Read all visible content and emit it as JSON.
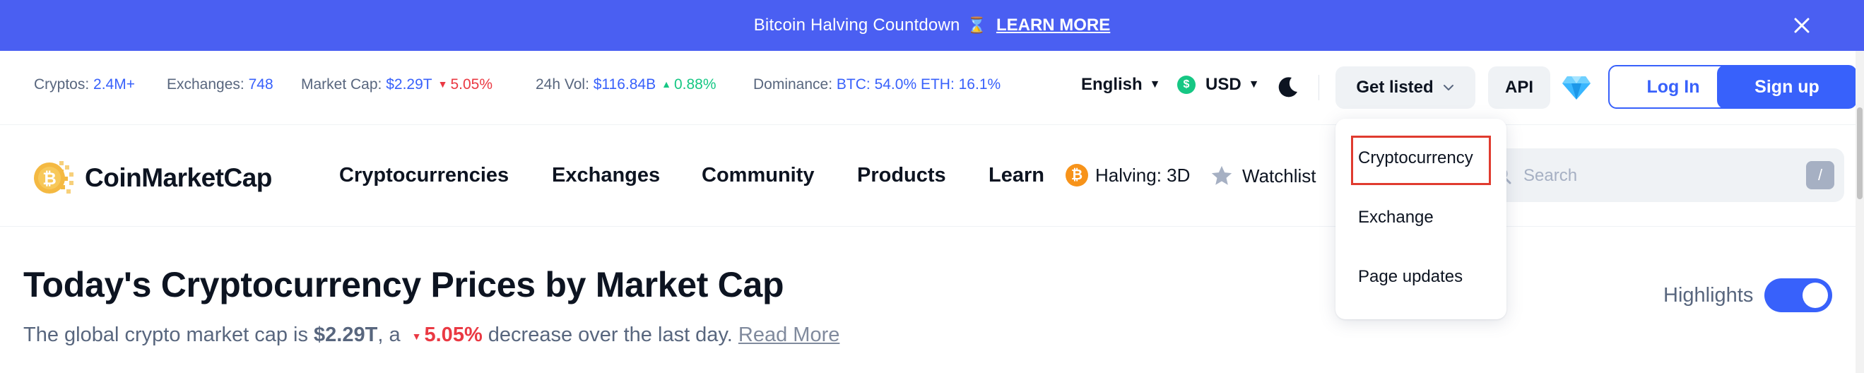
{
  "banner": {
    "text": "Bitcoin Halving Countdown",
    "link": "LEARN MORE"
  },
  "stats": {
    "cryptos_label": "Cryptos:",
    "cryptos_value": "2.4M+",
    "exchanges_label": "Exchanges:",
    "exchanges_value": "748",
    "marketcap_label": "Market Cap:",
    "marketcap_value": "$2.29T",
    "marketcap_change": "5.05%",
    "vol_label": "24h Vol:",
    "vol_value": "$116.84B",
    "vol_change": "0.88%",
    "dominance_label": "Dominance:",
    "dominance_value": "BTC: 54.0% ETH: 16.1%"
  },
  "toolbar": {
    "language": "English",
    "currency": "USD",
    "get_listed": "Get listed",
    "api": "API",
    "login": "Log In",
    "signup": "Sign up"
  },
  "nav": {
    "logo_text": "CoinMarketCap",
    "items": [
      "Cryptocurrencies",
      "Exchanges",
      "Community",
      "Products",
      "Learn"
    ],
    "halving": "Halving: 3D",
    "watchlist": "Watchlist",
    "search_placeholder": "Search",
    "search_shortcut": "/"
  },
  "dropdown": {
    "items": [
      "Cryptocurrency",
      "Exchange",
      "Page updates"
    ]
  },
  "page": {
    "title": "Today's Cryptocurrency Prices by Market Cap",
    "sub_prefix": "The global crypto market cap is",
    "sub_value": "$2.29T",
    "sub_mid": ", a",
    "sub_change": "5.05%",
    "sub_suffix": "decrease over the last day.",
    "read_more": "Read More",
    "highlights": "Highlights"
  },
  "colors": {
    "banner": "#4a5ff2",
    "accent": "#3861fb",
    "down": "#ea3943",
    "up": "#16c784"
  }
}
